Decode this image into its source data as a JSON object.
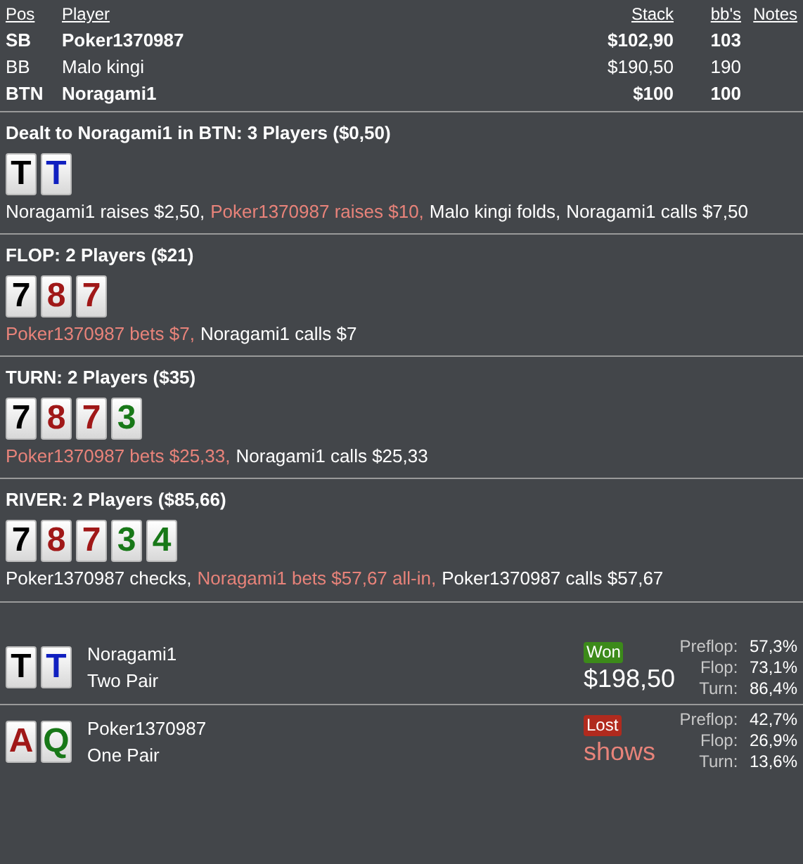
{
  "players_table": {
    "columns": [
      "Pos",
      "Player",
      "Stack",
      "bb's",
      "Notes"
    ],
    "rows": [
      {
        "pos": "SB",
        "player": "Poker1370987",
        "stack": "$102,90",
        "bbs": "103",
        "bold": true
      },
      {
        "pos": "BB",
        "player": "Malo kingi",
        "stack": "$190,50",
        "bbs": "190",
        "bold": false
      },
      {
        "pos": "BTN",
        "player": "Noragami1",
        "stack": "$100",
        "bbs": "100",
        "bold": true
      }
    ]
  },
  "streets": [
    {
      "title": "Dealt to Noragami1 in BTN: 3 Players ($0,50)",
      "cards": [
        {
          "rank": "T",
          "color": "#000000"
        },
        {
          "rank": "T",
          "color": "#1020c0"
        }
      ],
      "actions": [
        {
          "text": "Noragami1 raises $2,50,",
          "highlight": false
        },
        {
          "text": "Poker1370987 raises $10,",
          "highlight": true
        },
        {
          "text": "Malo kingi folds,",
          "highlight": false
        },
        {
          "text": "Noragami1 calls $7,50",
          "highlight": false
        }
      ]
    },
    {
      "title": "FLOP: 2 Players ($21)",
      "cards": [
        {
          "rank": "7",
          "color": "#000000"
        },
        {
          "rank": "8",
          "color": "#a01818"
        },
        {
          "rank": "7",
          "color": "#a01818"
        }
      ],
      "actions": [
        {
          "text": "Poker1370987 bets $7,",
          "highlight": true
        },
        {
          "text": "Noragami1 calls $7",
          "highlight": false
        }
      ]
    },
    {
      "title": "TURN: 2 Players ($35)",
      "cards": [
        {
          "rank": "7",
          "color": "#000000"
        },
        {
          "rank": "8",
          "color": "#a01818"
        },
        {
          "rank": "7",
          "color": "#a01818"
        },
        {
          "rank": "3",
          "color": "#187818"
        }
      ],
      "actions": [
        {
          "text": "Poker1370987 bets $25,33,",
          "highlight": true
        },
        {
          "text": "Noragami1 calls $25,33",
          "highlight": false
        }
      ]
    },
    {
      "title": "RIVER: 2 Players ($85,66)",
      "cards": [
        {
          "rank": "7",
          "color": "#000000"
        },
        {
          "rank": "8",
          "color": "#a01818"
        },
        {
          "rank": "7",
          "color": "#a01818"
        },
        {
          "rank": "3",
          "color": "#187818"
        },
        {
          "rank": "4",
          "color": "#187818"
        }
      ],
      "actions": [
        {
          "text": "Poker1370987 checks,",
          "highlight": false
        },
        {
          "text": "Noragami1 bets $57,67 all-in,",
          "highlight": true
        },
        {
          "text": "Poker1370987 calls $57,67",
          "highlight": false
        }
      ]
    }
  ],
  "results": [
    {
      "cards": [
        {
          "rank": "T",
          "color": "#000000"
        },
        {
          "rank": "T",
          "color": "#1020c0"
        }
      ],
      "name": "Noragami1",
      "hand": "Two Pair",
      "kind": "won",
      "badge": "Won",
      "amount": "$198,50",
      "equity": [
        {
          "label": "Preflop:",
          "value": "57,3%"
        },
        {
          "label": "Flop:",
          "value": "73,1%"
        },
        {
          "label": "Turn:",
          "value": "86,4%"
        }
      ]
    },
    {
      "cards": [
        {
          "rank": "A",
          "color": "#a01818"
        },
        {
          "rank": "Q",
          "color": "#187818"
        }
      ],
      "name": "Poker1370987",
      "hand": "One Pair",
      "kind": "lost",
      "badge": "Lost",
      "amount": "shows",
      "equity": [
        {
          "label": "Preflop:",
          "value": "42,7%"
        },
        {
          "label": "Flop:",
          "value": "26,9%"
        },
        {
          "label": "Turn:",
          "value": "13,6%"
        }
      ]
    }
  ]
}
